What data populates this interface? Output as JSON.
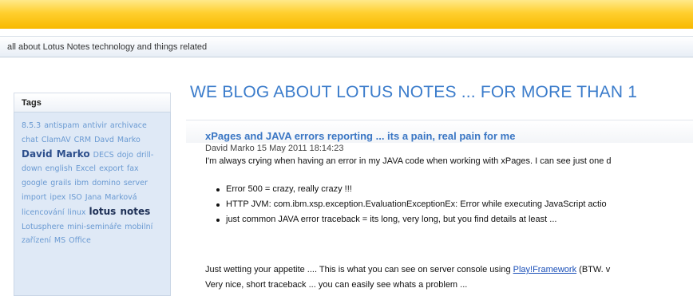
{
  "header": {
    "tagline": "all about Lotus Notes technology and things related"
  },
  "sidebar": {
    "title": "Tags",
    "tags": [
      {
        "label": "8.5.3",
        "size": "normal"
      },
      {
        "label": "antispam",
        "size": "normal"
      },
      {
        "label": "antivir",
        "size": "normal"
      },
      {
        "label": "archivace",
        "size": "normal"
      },
      {
        "label": "chat",
        "size": "normal"
      },
      {
        "label": "ClamAV",
        "size": "normal"
      },
      {
        "label": "CRM",
        "size": "normal"
      },
      {
        "label": "Davd Marko",
        "size": "normal"
      },
      {
        "label": "David Marko",
        "size": "big"
      },
      {
        "label": "DECS",
        "size": "normal"
      },
      {
        "label": "dojo",
        "size": "normal"
      },
      {
        "label": "drill-down",
        "size": "normal"
      },
      {
        "label": "english",
        "size": "normal"
      },
      {
        "label": "Excel",
        "size": "normal"
      },
      {
        "label": "export",
        "size": "normal"
      },
      {
        "label": "fax",
        "size": "normal"
      },
      {
        "label": "google",
        "size": "normal"
      },
      {
        "label": "grails",
        "size": "normal"
      },
      {
        "label": "ibm",
        "size": "normal"
      },
      {
        "label": "domino",
        "size": "normal"
      },
      {
        "label": "server",
        "size": "normal"
      },
      {
        "label": "import",
        "size": "normal"
      },
      {
        "label": "ipex",
        "size": "normal"
      },
      {
        "label": "ISO",
        "size": "normal"
      },
      {
        "label": "Jana",
        "size": "normal"
      },
      {
        "label": "Marková",
        "size": "normal"
      },
      {
        "label": "licencování",
        "size": "normal"
      },
      {
        "label": "linux",
        "size": "normal"
      },
      {
        "label": "lotus notes",
        "size": "bigger"
      },
      {
        "label": "Lotusphere",
        "size": "normal"
      },
      {
        "label": "mini-semináře",
        "size": "normal"
      },
      {
        "label": "mobilní",
        "size": "normal"
      },
      {
        "label": "zařízení",
        "size": "normal"
      },
      {
        "label": "MS Office",
        "size": "normal"
      }
    ]
  },
  "main": {
    "heading": "WE BLOG ABOUT LOTUS NOTES ... FOR MORE THAN 1",
    "post": {
      "title": "xPages and JAVA errors reporting ... its a pain, real pain for me",
      "meta": "David Marko  15 May 2011 18:14:23",
      "intro": "I'm always crying when having an error  in my JAVA code when working with xPages. I can see just one d",
      "bullets": [
        "Error 500 = crazy, really crazy !!!",
        "HTTP JVM: com.ibm.xsp.exception.EvaluationExceptionEx: Error while executing JavaScript actio",
        "just common JAVA error traceback = its long, very long, but you find details at least ..."
      ],
      "para_before_link": "Just wetting your appetite .... This is what you can see on server console using ",
      "para_link": "Play!Framework",
      "para_after_link": " (BTW. v",
      "para_line2": "Very nice, short traceback ... you can easily see whats a problem ..."
    }
  }
}
